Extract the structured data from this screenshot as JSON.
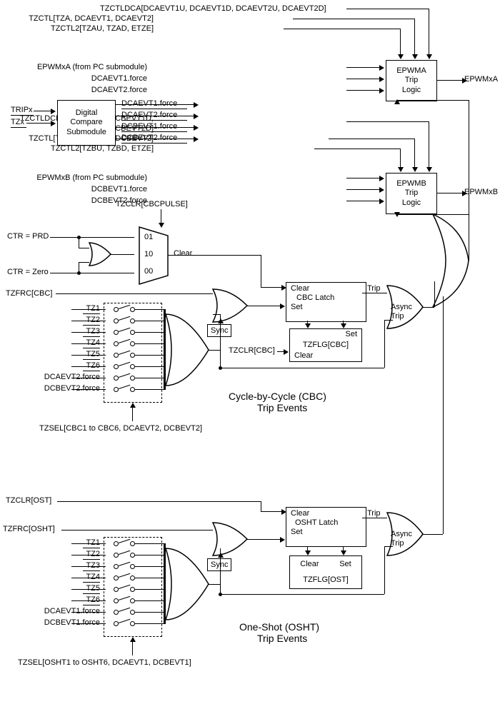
{
  "top": {
    "tzctldca": "TZCTLDCA[DCAEVT1U, DCAEVT1D, DCAEVT2U, DCAEVT2D]",
    "tzctl_a": "TZCTL[TZA, DCAEVT1, DCAEVT2]",
    "tzctl2_a": "TZCTL2[TZAU, TZAD, ETZE]",
    "epwmxa_in": "EPWMxA (from PC submodule)",
    "dcaevt1f": "DCAEVT1.force",
    "dcaevt2f": "DCAEVT2.force",
    "epwma_box_l1": "EPWMA",
    "epwma_box_l2": "Trip",
    "epwma_box_l3": "Logic",
    "epwmxa_out": "EPWMxA",
    "tzctldcb": "TZCTLDCB[DCBEVT1U, DCBEVT1D,",
    "tzctldcb2": "DCBEVT2U, DCBEVT2D]",
    "tzctl_b": "TZCTL[TZB, DCBEVT1, DCBEVT2]",
    "tzctl2_b": "TZCTL2[TZBU, TZBD, ETZE]",
    "epwmxb_in": "EPWMxB (from PC submodule)",
    "dcbevt1f": "DCBEVT1.force",
    "dcbevt2f": "DCBEVT2.force",
    "epwmb_box_l1": "EPWMB",
    "epwmb_box_l2": "Trip",
    "epwmb_box_l3": "Logic",
    "epwmxb_out": "EPWMxB"
  },
  "dc": {
    "tripx": "TRIPx",
    "tzx": "TZx",
    "box_l1": "Digital",
    "box_l2": "Compare",
    "box_l3": "Submodule",
    "out1": "DCAEVT1.force",
    "out2": "DCAEVT2.force",
    "out3": "DCBEVT1.force",
    "out4": "DCBEVT2.force"
  },
  "cbc": {
    "tzclr_cbcpulse": "TZCLR[CBCPULSE]",
    "ctr_prd": "CTR = PRD",
    "ctr_zero": "CTR = Zero",
    "mux01": "01",
    "mux10": "10",
    "mux00": "00",
    "clear": "Clear",
    "tzfrc": "TZFRC[CBC]",
    "tz1": "TZ1",
    "tz2": "TZ2",
    "tz3": "TZ3",
    "tz4": "TZ4",
    "tz5": "TZ5",
    "tz6": "TZ6",
    "dca2f": "DCAEVT2.force",
    "dcb2f": "DCBEVT2.force",
    "sync": "Sync",
    "latch_clear": "Clear",
    "latch_name": "CBC Latch",
    "latch_set": "Set",
    "trip": "Trip",
    "flg_set": "Set",
    "flg_name": "TZFLG[CBC]",
    "flg_clear": "Clear",
    "tzclr_cbc": "TZCLR[CBC]",
    "async": "Async",
    "async2": "Trip",
    "section": "Cycle-by-Cycle (CBC)",
    "section2": "Trip Events",
    "tzsel": "TZSEL[CBC1 to CBC6, DCAEVT2, DCBEVT2]"
  },
  "osht": {
    "tzclr": "TZCLR[OST]",
    "tzfrc": "TZFRC[OSHT]",
    "tz1": "TZ1",
    "tz2": "TZ2",
    "tz3": "TZ3",
    "tz4": "TZ4",
    "tz5": "TZ5",
    "tz6": "TZ6",
    "dca1f": "DCAEVT1.force",
    "dcb1f": "DCBEVT1.force",
    "sync": "Sync",
    "latch_clear": "Clear",
    "latch_name": "OSHT Latch",
    "latch_set": "Set",
    "trip": "Trip",
    "flg_clear": "Clear",
    "flg_set": "Set",
    "flg_name": "TZFLG[OST]",
    "async": "Async",
    "async2": "Trip",
    "section": "One-Shot (OSHT)",
    "section2": "Trip Events",
    "tzsel": "TZSEL[OSHT1 to OSHT6, DCAEVT1, DCBEVT1]"
  }
}
